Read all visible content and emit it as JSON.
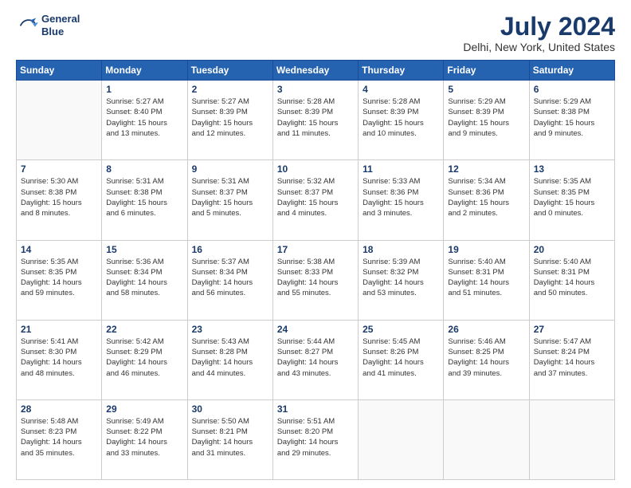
{
  "logo": {
    "line1": "General",
    "line2": "Blue"
  },
  "title": "July 2024",
  "subtitle": "Delhi, New York, United States",
  "header_days": [
    "Sunday",
    "Monday",
    "Tuesday",
    "Wednesday",
    "Thursday",
    "Friday",
    "Saturday"
  ],
  "weeks": [
    [
      {
        "day": "",
        "info": ""
      },
      {
        "day": "1",
        "info": "Sunrise: 5:27 AM\nSunset: 8:40 PM\nDaylight: 15 hours\nand 13 minutes."
      },
      {
        "day": "2",
        "info": "Sunrise: 5:27 AM\nSunset: 8:39 PM\nDaylight: 15 hours\nand 12 minutes."
      },
      {
        "day": "3",
        "info": "Sunrise: 5:28 AM\nSunset: 8:39 PM\nDaylight: 15 hours\nand 11 minutes."
      },
      {
        "day": "4",
        "info": "Sunrise: 5:28 AM\nSunset: 8:39 PM\nDaylight: 15 hours\nand 10 minutes."
      },
      {
        "day": "5",
        "info": "Sunrise: 5:29 AM\nSunset: 8:39 PM\nDaylight: 15 hours\nand 9 minutes."
      },
      {
        "day": "6",
        "info": "Sunrise: 5:29 AM\nSunset: 8:38 PM\nDaylight: 15 hours\nand 9 minutes."
      }
    ],
    [
      {
        "day": "7",
        "info": "Sunrise: 5:30 AM\nSunset: 8:38 PM\nDaylight: 15 hours\nand 8 minutes."
      },
      {
        "day": "8",
        "info": "Sunrise: 5:31 AM\nSunset: 8:38 PM\nDaylight: 15 hours\nand 6 minutes."
      },
      {
        "day": "9",
        "info": "Sunrise: 5:31 AM\nSunset: 8:37 PM\nDaylight: 15 hours\nand 5 minutes."
      },
      {
        "day": "10",
        "info": "Sunrise: 5:32 AM\nSunset: 8:37 PM\nDaylight: 15 hours\nand 4 minutes."
      },
      {
        "day": "11",
        "info": "Sunrise: 5:33 AM\nSunset: 8:36 PM\nDaylight: 15 hours\nand 3 minutes."
      },
      {
        "day": "12",
        "info": "Sunrise: 5:34 AM\nSunset: 8:36 PM\nDaylight: 15 hours\nand 2 minutes."
      },
      {
        "day": "13",
        "info": "Sunrise: 5:35 AM\nSunset: 8:35 PM\nDaylight: 15 hours\nand 0 minutes."
      }
    ],
    [
      {
        "day": "14",
        "info": "Sunrise: 5:35 AM\nSunset: 8:35 PM\nDaylight: 14 hours\nand 59 minutes."
      },
      {
        "day": "15",
        "info": "Sunrise: 5:36 AM\nSunset: 8:34 PM\nDaylight: 14 hours\nand 58 minutes."
      },
      {
        "day": "16",
        "info": "Sunrise: 5:37 AM\nSunset: 8:34 PM\nDaylight: 14 hours\nand 56 minutes."
      },
      {
        "day": "17",
        "info": "Sunrise: 5:38 AM\nSunset: 8:33 PM\nDaylight: 14 hours\nand 55 minutes."
      },
      {
        "day": "18",
        "info": "Sunrise: 5:39 AM\nSunset: 8:32 PM\nDaylight: 14 hours\nand 53 minutes."
      },
      {
        "day": "19",
        "info": "Sunrise: 5:40 AM\nSunset: 8:31 PM\nDaylight: 14 hours\nand 51 minutes."
      },
      {
        "day": "20",
        "info": "Sunrise: 5:40 AM\nSunset: 8:31 PM\nDaylight: 14 hours\nand 50 minutes."
      }
    ],
    [
      {
        "day": "21",
        "info": "Sunrise: 5:41 AM\nSunset: 8:30 PM\nDaylight: 14 hours\nand 48 minutes."
      },
      {
        "day": "22",
        "info": "Sunrise: 5:42 AM\nSunset: 8:29 PM\nDaylight: 14 hours\nand 46 minutes."
      },
      {
        "day": "23",
        "info": "Sunrise: 5:43 AM\nSunset: 8:28 PM\nDaylight: 14 hours\nand 44 minutes."
      },
      {
        "day": "24",
        "info": "Sunrise: 5:44 AM\nSunset: 8:27 PM\nDaylight: 14 hours\nand 43 minutes."
      },
      {
        "day": "25",
        "info": "Sunrise: 5:45 AM\nSunset: 8:26 PM\nDaylight: 14 hours\nand 41 minutes."
      },
      {
        "day": "26",
        "info": "Sunrise: 5:46 AM\nSunset: 8:25 PM\nDaylight: 14 hours\nand 39 minutes."
      },
      {
        "day": "27",
        "info": "Sunrise: 5:47 AM\nSunset: 8:24 PM\nDaylight: 14 hours\nand 37 minutes."
      }
    ],
    [
      {
        "day": "28",
        "info": "Sunrise: 5:48 AM\nSunset: 8:23 PM\nDaylight: 14 hours\nand 35 minutes."
      },
      {
        "day": "29",
        "info": "Sunrise: 5:49 AM\nSunset: 8:22 PM\nDaylight: 14 hours\nand 33 minutes."
      },
      {
        "day": "30",
        "info": "Sunrise: 5:50 AM\nSunset: 8:21 PM\nDaylight: 14 hours\nand 31 minutes."
      },
      {
        "day": "31",
        "info": "Sunrise: 5:51 AM\nSunset: 8:20 PM\nDaylight: 14 hours\nand 29 minutes."
      },
      {
        "day": "",
        "info": ""
      },
      {
        "day": "",
        "info": ""
      },
      {
        "day": "",
        "info": ""
      }
    ]
  ]
}
